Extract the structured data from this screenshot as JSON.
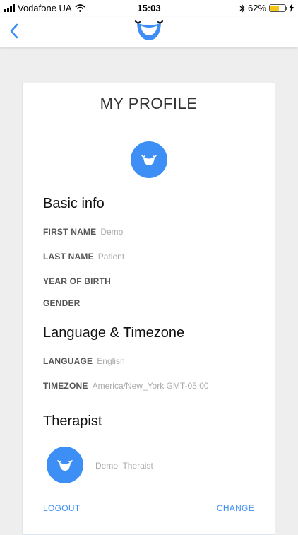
{
  "status_bar": {
    "carrier": "Vodafone UA",
    "time": "15:03",
    "battery_percent": "62%",
    "battery_level": 0.62
  },
  "navbar": {
    "back_icon": "chevron-left-icon",
    "logo_icon": "smile-logo-icon"
  },
  "profile": {
    "title": "MY PROFILE",
    "avatar_icon": "smile-avatar-icon"
  },
  "basic_info": {
    "heading": "Basic info",
    "first_name_label": "FIRST NAME",
    "first_name_value": "Demo",
    "last_name_label": "LAST NAME",
    "last_name_value": "Patient",
    "year_of_birth_label": "YEAR OF BIRTH",
    "gender_label": "GENDER"
  },
  "language_timezone": {
    "heading": "Language & Timezone",
    "language_label": "LANGUAGE",
    "language_value": "English",
    "timezone_label": "TIMEZONE",
    "timezone_value": "America/New_York GMT-05:00"
  },
  "therapist": {
    "heading": "Therapist",
    "name": "Demo  Theraist",
    "avatar_icon": "smile-avatar-icon"
  },
  "actions": {
    "logout_label": "LOGOUT",
    "change_label": "CHANGE"
  },
  "colors": {
    "accent": "#3d8ff6",
    "battery": "#f5c518",
    "background": "#eeeeee"
  }
}
